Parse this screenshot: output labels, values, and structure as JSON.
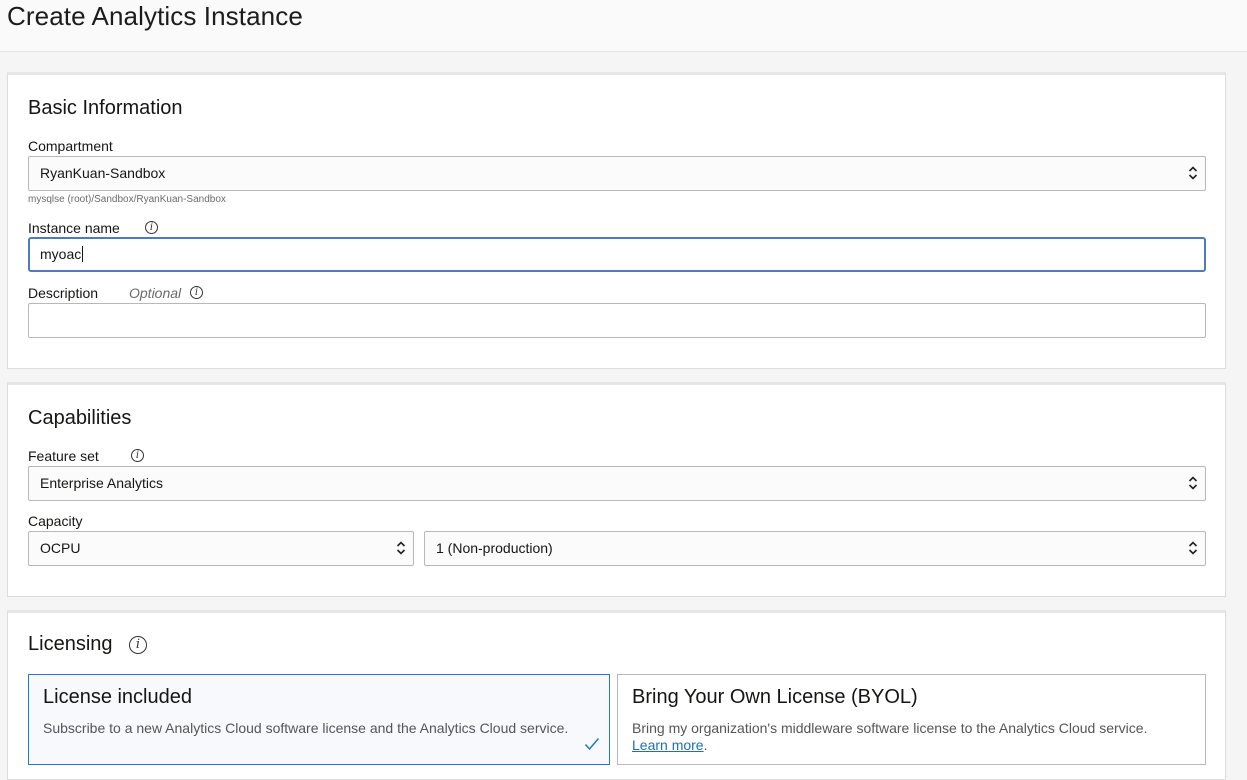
{
  "page": {
    "title": "Create Analytics Instance"
  },
  "basic_info": {
    "title": "Basic Information",
    "compartment_label": "Compartment",
    "compartment_value": "RyanKuan-Sandbox",
    "compartment_path": "mysqlse (root)/Sandbox/RyanKuan-Sandbox",
    "instance_name_label": "Instance name",
    "instance_name_value": "myoac",
    "description_label": "Description",
    "description_optional": "Optional",
    "description_value": ""
  },
  "capabilities": {
    "title": "Capabilities",
    "feature_set_label": "Feature set",
    "feature_set_value": "Enterprise Analytics",
    "capacity_label": "Capacity",
    "capacity_type_value": "OCPU",
    "capacity_amount_value": "1 (Non-production)"
  },
  "licensing": {
    "title": "Licensing",
    "options": [
      {
        "title": "License included",
        "description": "Subscribe to a new Analytics Cloud software license and the Analytics Cloud service.",
        "selected": true
      },
      {
        "title": "Bring Your Own License (BYOL)",
        "description": "Bring my organization's middleware software license to the Analytics Cloud service.",
        "link": "Learn more",
        "link_suffix": ".",
        "selected": false
      }
    ]
  },
  "icons": {
    "info": "info-icon",
    "select_arrows": "up-down-chevron-icon",
    "selected_check": "checkmark-icon"
  },
  "colors": {
    "accent": "#227ab6",
    "focus_border": "#4a7cc0",
    "link": "#1f6fb6"
  }
}
